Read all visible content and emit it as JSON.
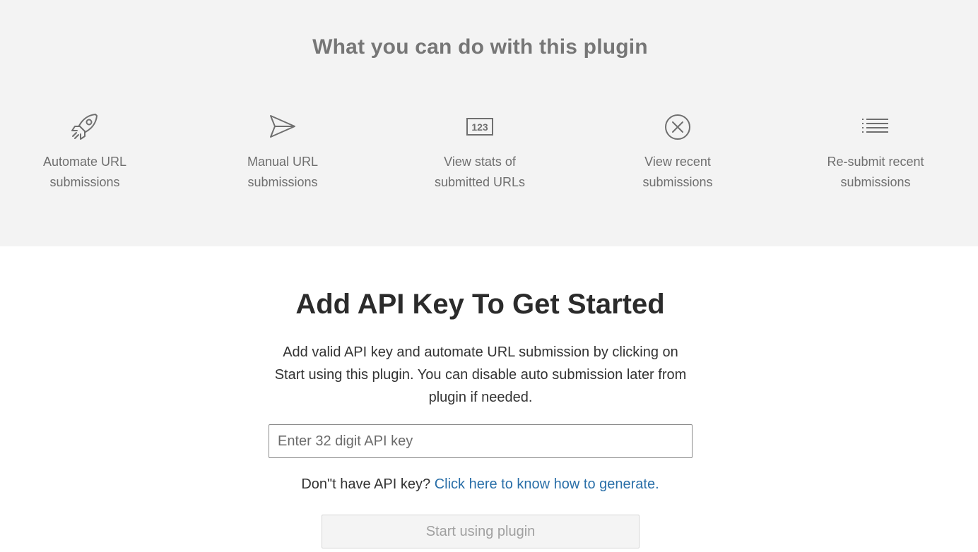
{
  "features": {
    "title": "What you can do with this plugin",
    "items": [
      {
        "icon": "rocket-icon",
        "label": "Automate URL\nsubmissions"
      },
      {
        "icon": "send-icon",
        "label": "Manual URL\nsubmissions"
      },
      {
        "icon": "numbers-123-icon",
        "label": "View stats of\nsubmitted URLs"
      },
      {
        "icon": "circle-x-icon",
        "label": "View recent\nsubmissions"
      },
      {
        "icon": "list-icon",
        "label": "Re-submit recent\nsubmissions"
      }
    ]
  },
  "main": {
    "title": "Add API Key To Get Started",
    "description": "Add valid API key and automate URL submission by clicking on Start using this plugin. You can disable auto submission later from plugin if needed.",
    "input": {
      "placeholder": "Enter 32 digit API key",
      "value": ""
    },
    "help_text": "Don\"t have API key?",
    "help_link": "Click here to know how to generate.",
    "start_button": "Start using plugin"
  },
  "colors": {
    "features_bg": "#f3f3f3",
    "link": "#2a6fa8",
    "button_disabled_text": "#a0a0a0"
  }
}
